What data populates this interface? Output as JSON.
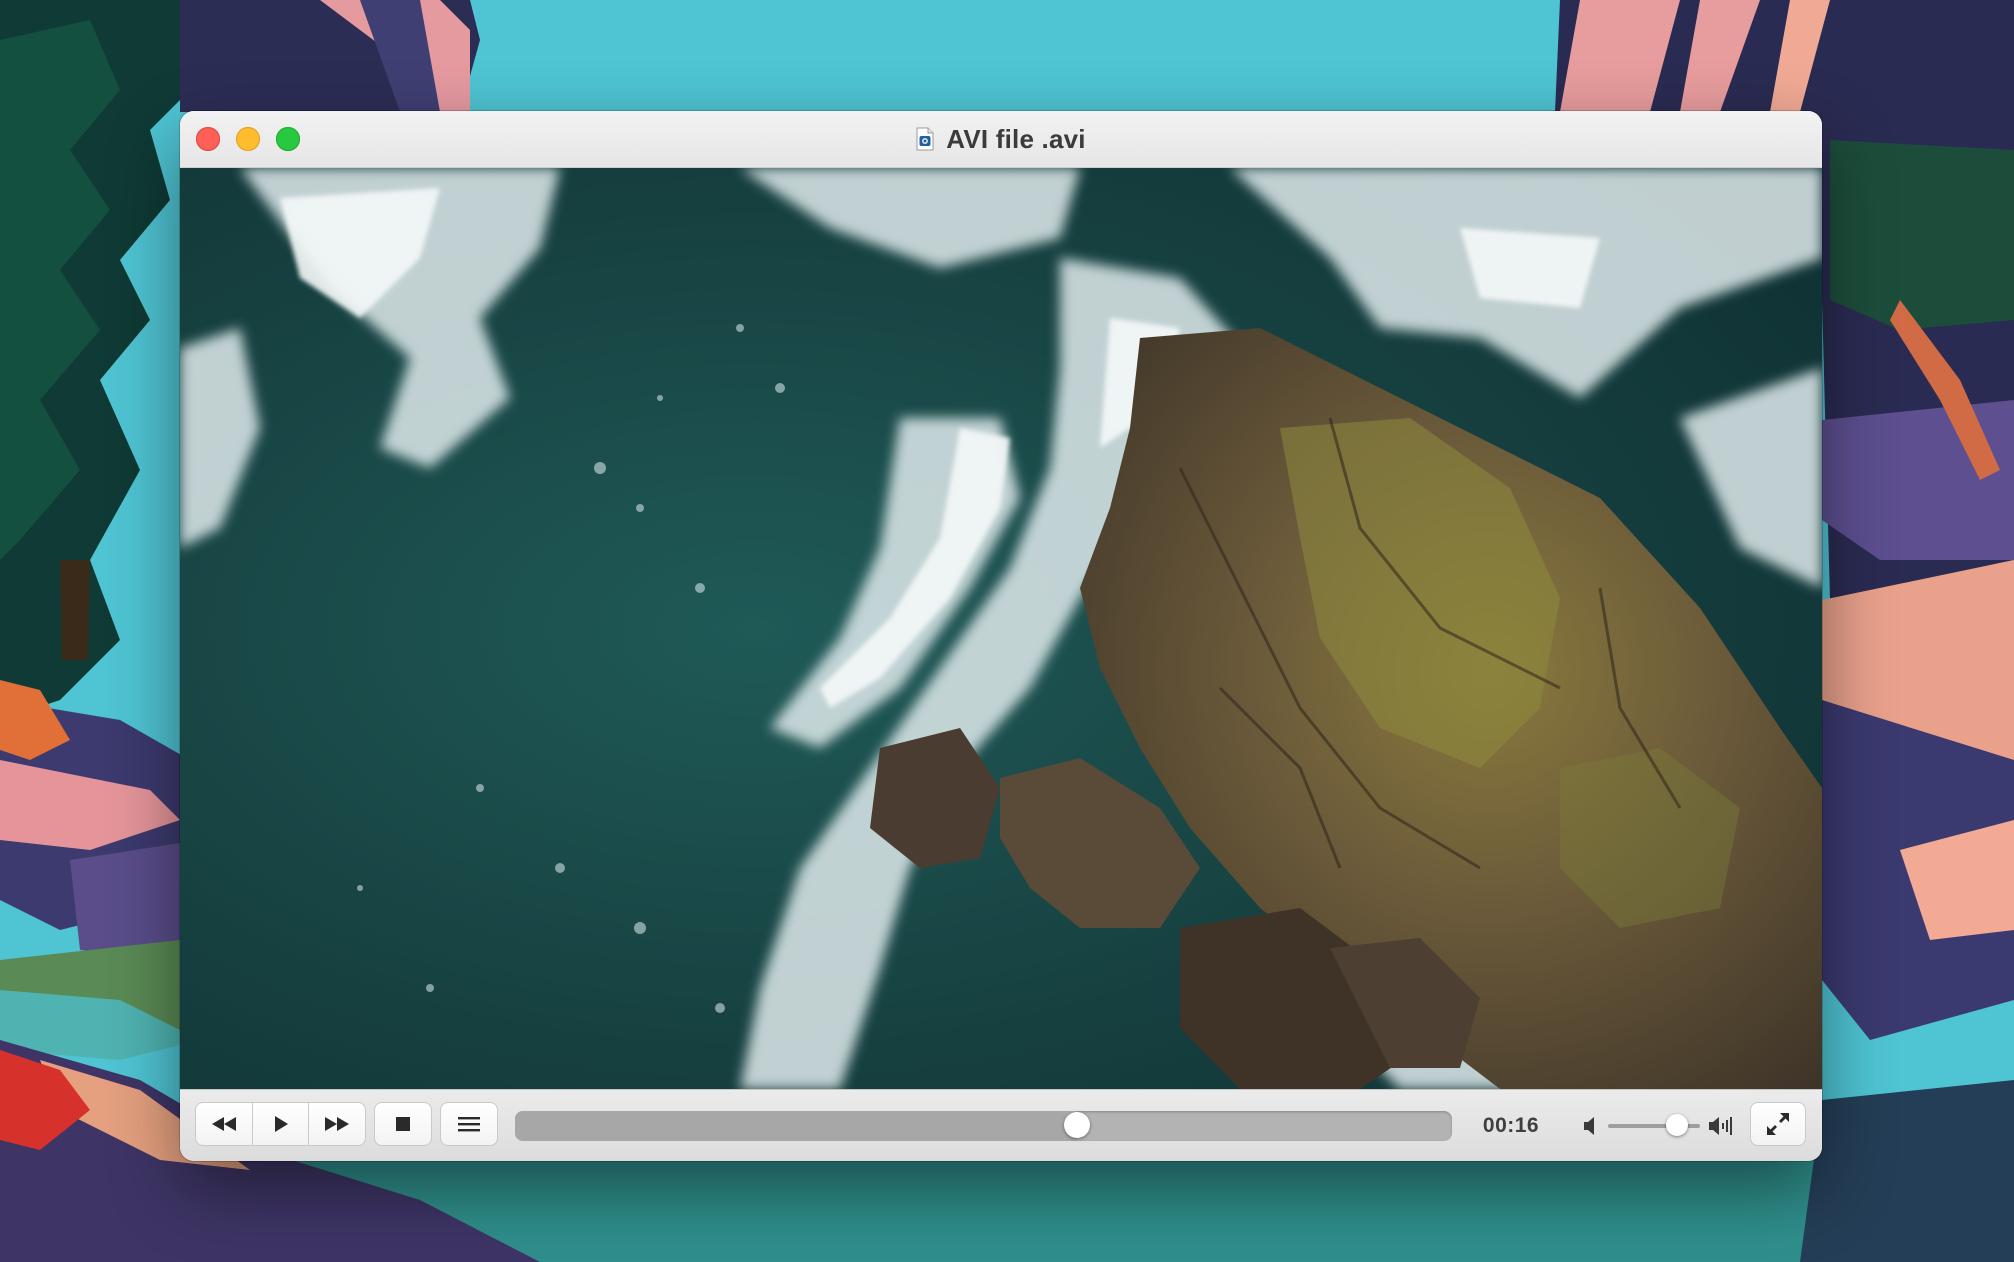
{
  "window": {
    "title": "AVI file .avi"
  },
  "playback": {
    "elapsed": "00:16",
    "progress": 0.6,
    "volume": 0.75
  },
  "controls": {
    "rewind_icon": "rewind-icon",
    "play_icon": "play-icon",
    "fast_forward_icon": "fast-forward-icon",
    "stop_icon": "stop-icon",
    "playlist_icon": "playlist-icon",
    "fullscreen_icon": "fullscreen-icon",
    "volume_low_icon": "speaker-low-icon",
    "volume_high_icon": "speaker-high-icon"
  },
  "colors": {
    "close": "#fe5f57",
    "minimize": "#febc2e",
    "zoom": "#28c840"
  }
}
